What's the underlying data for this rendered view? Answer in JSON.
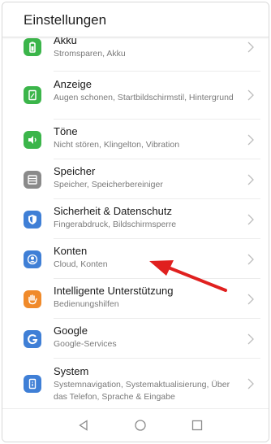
{
  "header": {
    "title": "Einstellungen"
  },
  "settings": {
    "items": [
      {
        "title": "Akku",
        "subtitle": "Stromsparen, Akku",
        "icon": "battery-icon",
        "color": "#3bb54a"
      },
      {
        "title": "Anzeige",
        "subtitle": "Augen schonen, Startbildschirmstil, Hintergrund",
        "icon": "display-icon",
        "color": "#3bb54a"
      },
      {
        "title": "Töne",
        "subtitle": "Nicht stören, Klingelton, Vibration",
        "icon": "sound-icon",
        "color": "#3bb54a"
      },
      {
        "title": "Speicher",
        "subtitle": "Speicher, Speicherbereiniger",
        "icon": "storage-icon",
        "color": "#8a8a8a"
      },
      {
        "title": "Sicherheit & Datenschutz",
        "subtitle": "Fingerabdruck, Bildschirmsperre",
        "icon": "shield-icon",
        "color": "#3f7fd6"
      },
      {
        "title": "Konten",
        "subtitle": "Cloud, Konten",
        "icon": "account-icon",
        "color": "#3f7fd6"
      },
      {
        "title": "Intelligente Unterstützung",
        "subtitle": "Bedienungshilfen",
        "icon": "hand-icon",
        "color": "#f08a2a"
      },
      {
        "title": "Google",
        "subtitle": "Google-Services",
        "icon": "google-icon",
        "color": "#3f7fd6"
      },
      {
        "title": "System",
        "subtitle": "Systemnavigation, Systemaktualisierung, Über das Telefon, Sprache & Eingabe",
        "icon": "phone-info-icon",
        "color": "#3f7fd6"
      }
    ]
  },
  "navbar": {
    "back": "back-icon",
    "home": "home-icon",
    "recents": "recents-icon"
  },
  "annotation": {
    "color": "#e0201f",
    "target": "Konten"
  }
}
